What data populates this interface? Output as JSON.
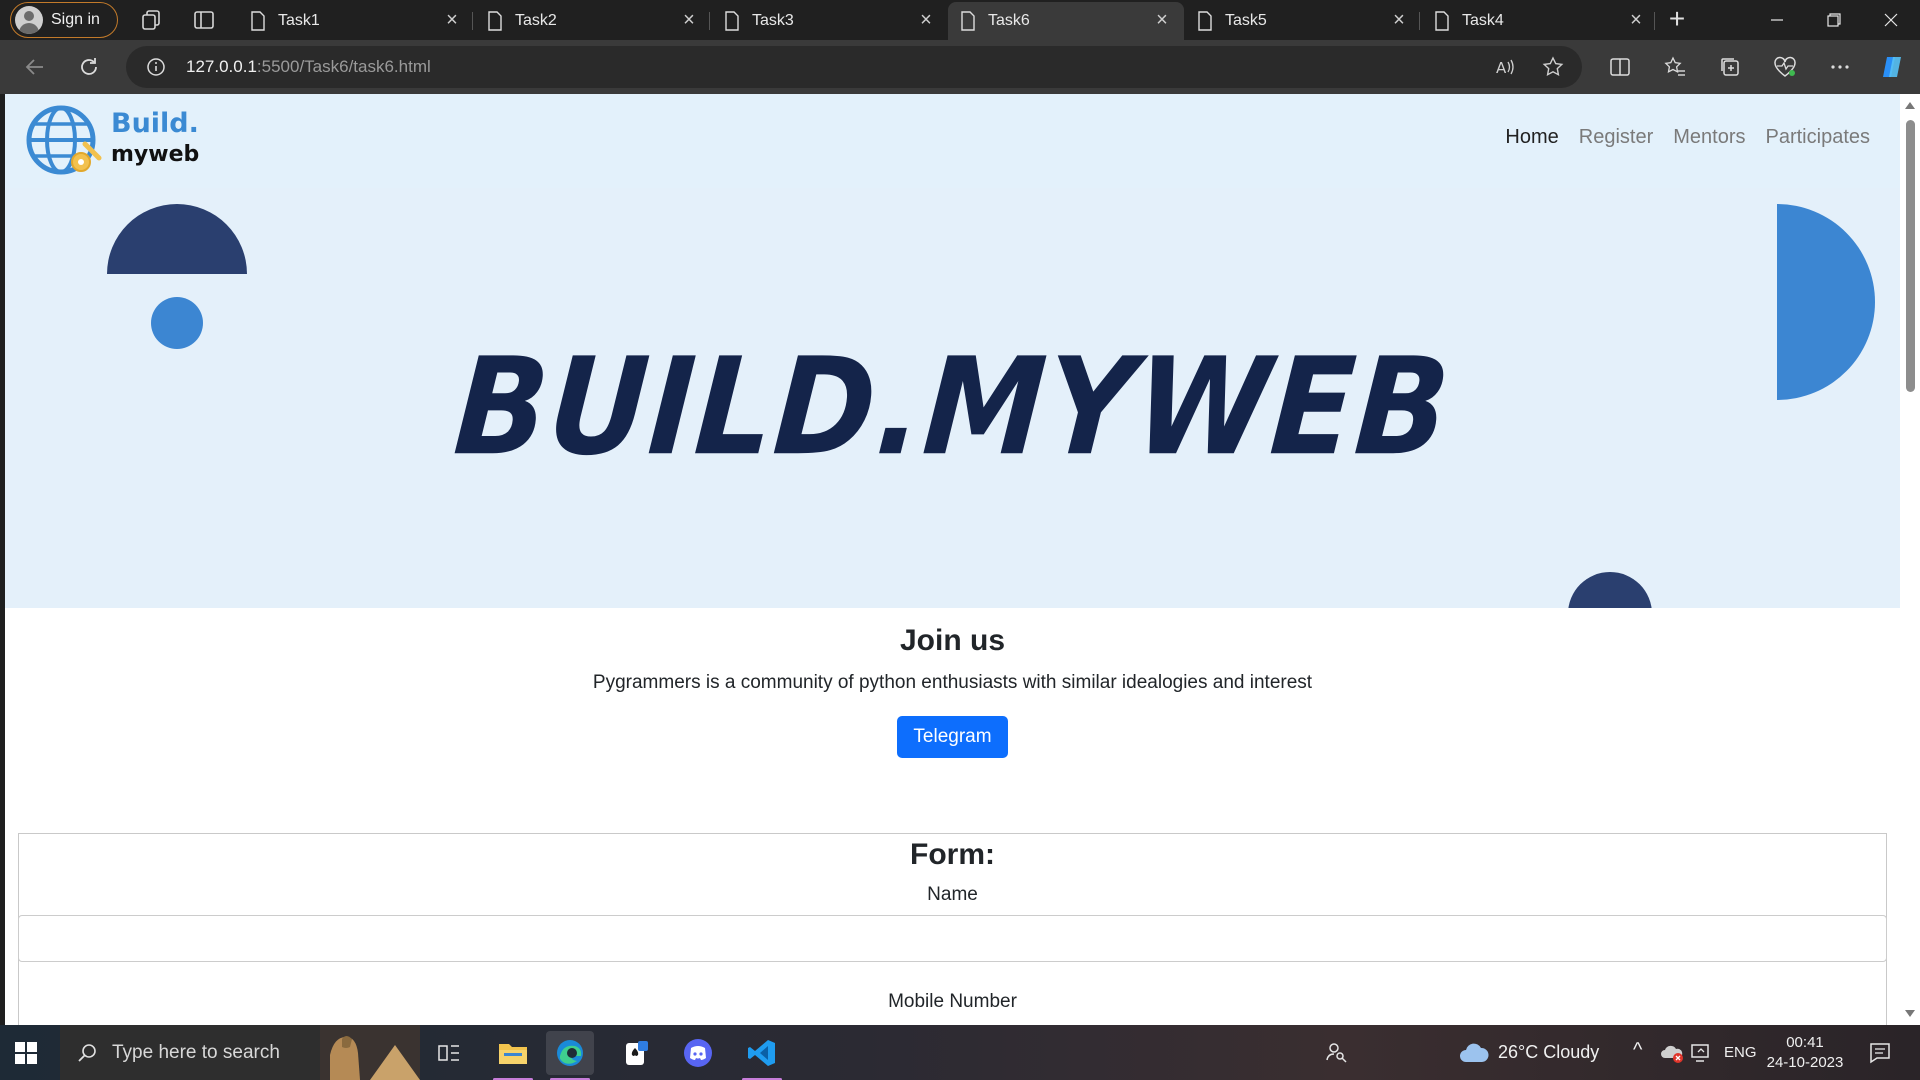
{
  "browser": {
    "signin_label": "Sign in",
    "tabs": [
      {
        "label": "Task1",
        "active": false
      },
      {
        "label": "Task2",
        "active": false
      },
      {
        "label": "Task3",
        "active": false
      },
      {
        "label": "Task6",
        "active": true
      },
      {
        "label": "Task5",
        "active": false
      },
      {
        "label": "Task4",
        "active": false
      }
    ],
    "url_host": "127.0.0.1",
    "url_rest": ":5500/Task6/task6.html",
    "accent": "#c27a2a"
  },
  "page": {
    "logo": {
      "line1": "Build.",
      "line2": "myweb"
    },
    "nav": [
      {
        "label": "Home",
        "active": true
      },
      {
        "label": "Register",
        "active": false
      },
      {
        "label": "Mentors",
        "active": false
      },
      {
        "label": "Participates",
        "active": false
      }
    ],
    "hero_title": "BUILD.MYWEB",
    "join": {
      "heading": "Join us",
      "text": "Pygrammers is a community of python enthusiasts with similar idealogies and interest",
      "button": "Telegram"
    },
    "form": {
      "title": "Form:",
      "fields": [
        {
          "label": "Name",
          "value": ""
        },
        {
          "label": "Mobile Number",
          "value": ""
        }
      ]
    },
    "colors": {
      "navbar_bg": "#e3f1fb",
      "hero_dark": "#2a3f6f",
      "hero_light": "#3c86d2",
      "button": "#0d6efd"
    }
  },
  "taskbar": {
    "search_placeholder": "Type here to search",
    "weather": "26°C  Cloudy",
    "language": "ENG",
    "time": "00:41",
    "date": "24-10-2023",
    "apps": [
      "file-explorer",
      "edge",
      "solitaire",
      "discord",
      "vscode"
    ]
  }
}
